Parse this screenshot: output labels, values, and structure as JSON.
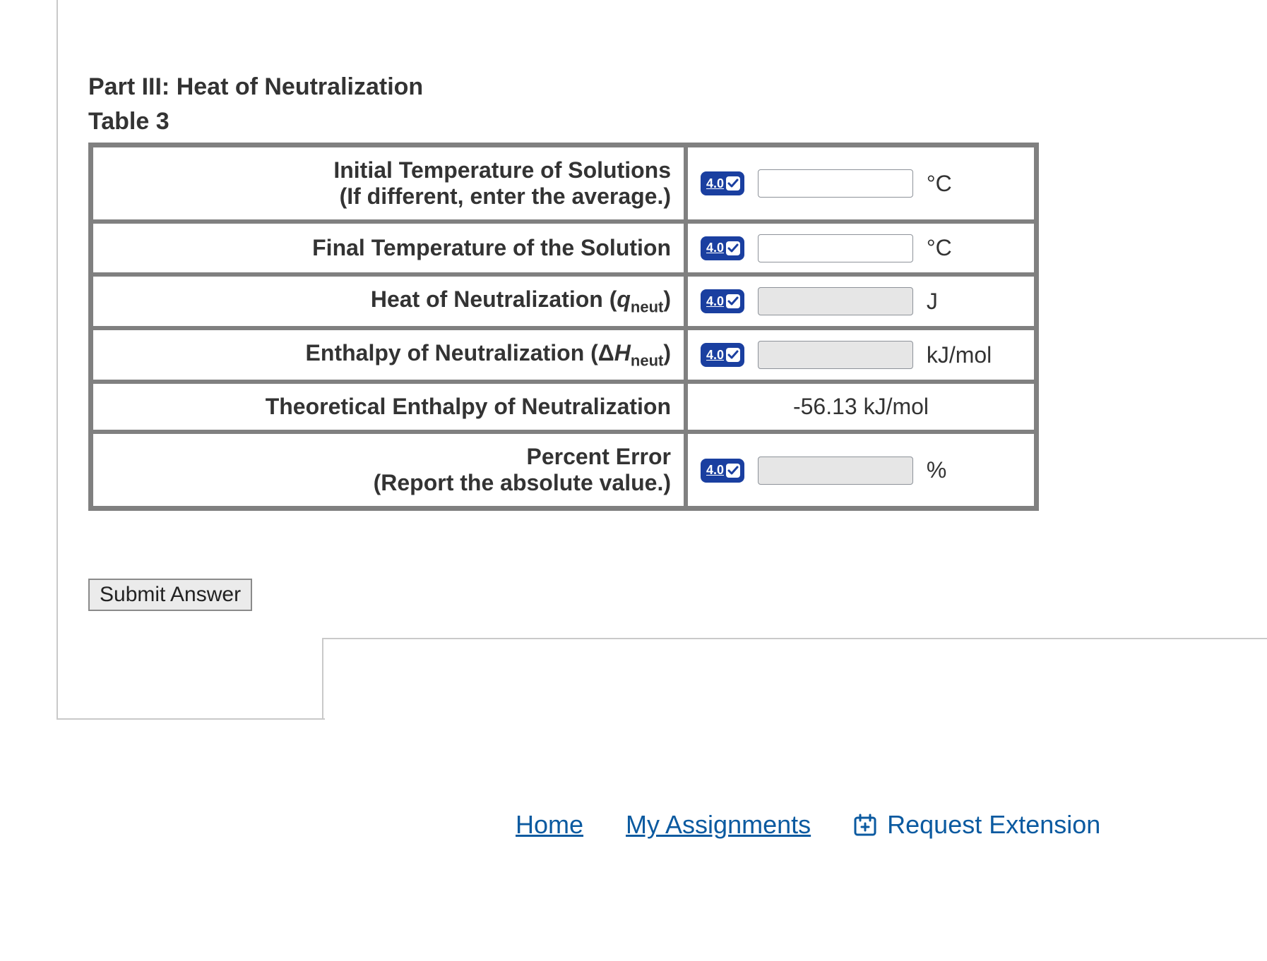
{
  "part_title": "Part III: Heat of Neutralization",
  "table_title": "Table 3",
  "badge_value": "4.0",
  "rows": [
    {
      "label_main": "Initial Temperature of Solutions",
      "label_sub": "(If different, enter the average.)",
      "unit": "°C",
      "input_gray": false
    },
    {
      "label_main": "Final Temperature of the Solution",
      "label_sub": "",
      "unit": "°C",
      "input_gray": false
    },
    {
      "label_html_pre": "Heat of Neutralization (",
      "var_letter": "q",
      "var_sub": "neut",
      "label_html_post": ")",
      "unit": "J",
      "input_gray": true
    },
    {
      "label_html_pre": "Enthalpy of Neutralization (Δ",
      "var_letter": "H",
      "var_sub": "neut",
      "label_html_post": ")",
      "unit": "kJ/mol",
      "input_gray": true
    },
    {
      "label_main": "Theoretical Enthalpy of Neutralization",
      "static_value": "-56.13 kJ/mol"
    },
    {
      "label_main": "Percent Error",
      "label_sub": "(Report the absolute value.)",
      "unit": "%",
      "input_gray": true
    }
  ],
  "submit_label": "Submit Answer",
  "footer": {
    "home": "Home",
    "assignments": "My Assignments",
    "request_ext": "Request Extension"
  }
}
